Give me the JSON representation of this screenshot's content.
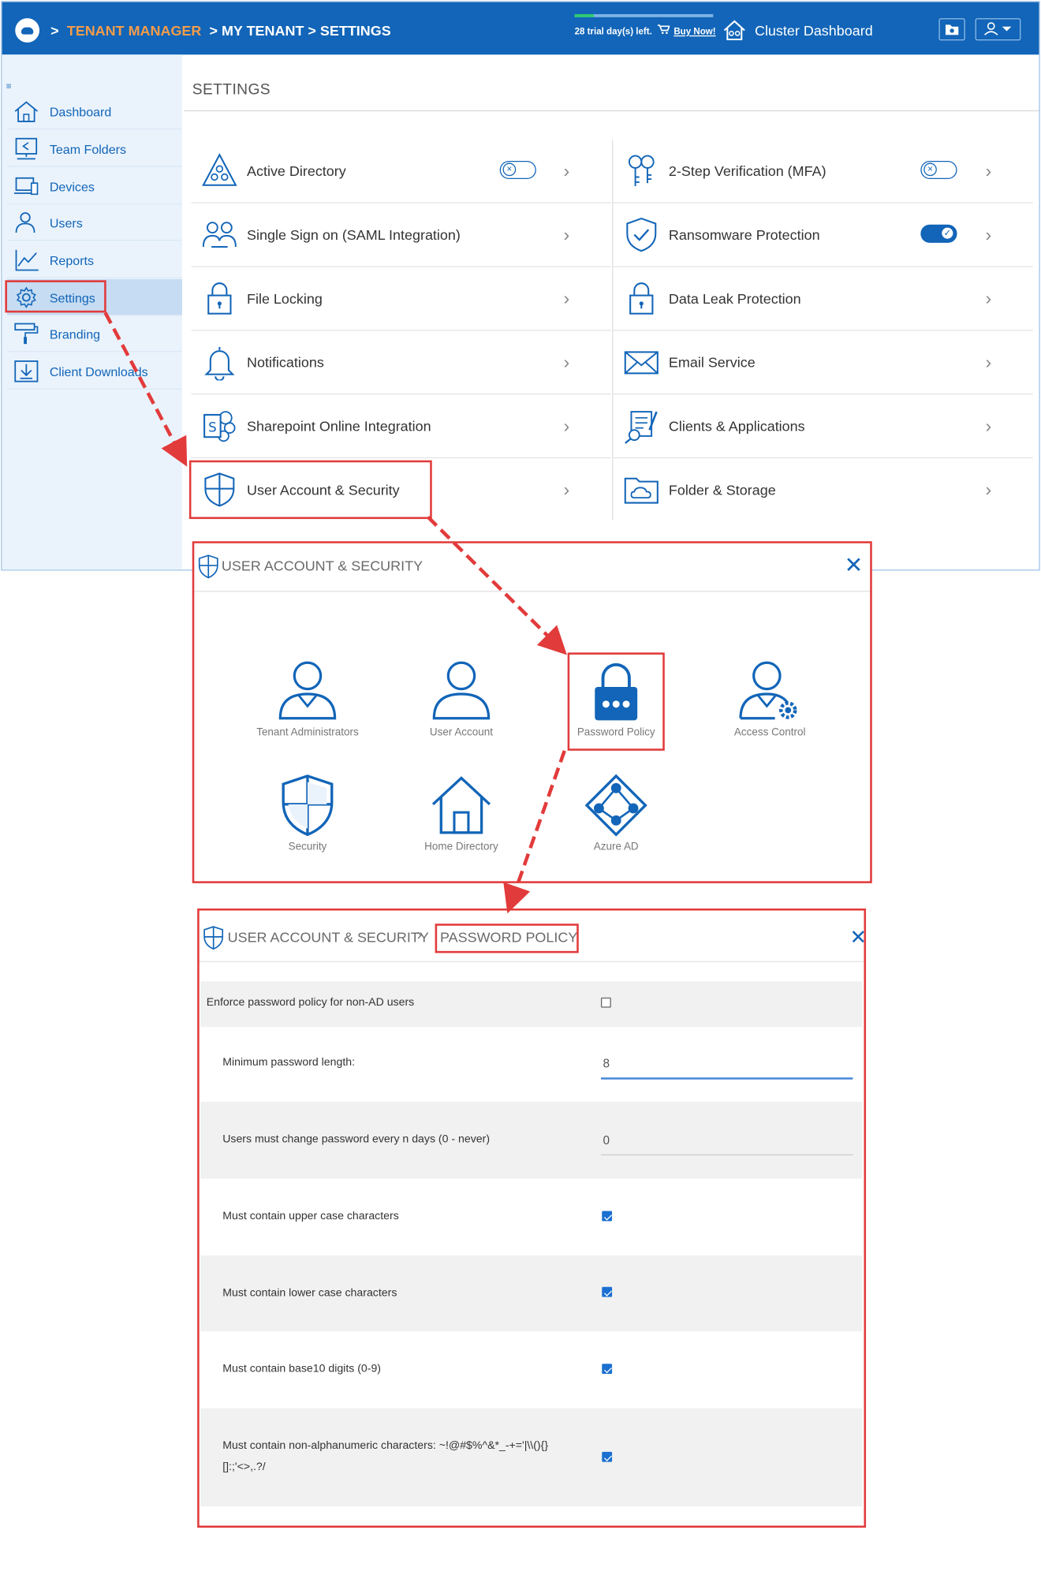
{
  "topbar": {
    "breadcrumb": [
      ">",
      "TENANT MANAGER",
      "> MY TENANT",
      "> SETTINGS"
    ],
    "trial_text": "28 trial day(s) left.",
    "trial_progress": 0.14,
    "buy_now": "Buy Now!",
    "cluster_dashboard": "Cluster Dashboard"
  },
  "sidebar": {
    "items": [
      {
        "label": "Dashboard",
        "icon": "home-icon"
      },
      {
        "label": "Team Folders",
        "icon": "team-folders-icon"
      },
      {
        "label": "Devices",
        "icon": "devices-icon"
      },
      {
        "label": "Users",
        "icon": "users-icon"
      },
      {
        "label": "Reports",
        "icon": "reports-icon"
      },
      {
        "label": "Settings",
        "icon": "gear-icon",
        "active": true
      },
      {
        "label": "Branding",
        "icon": "paint-roller-icon"
      },
      {
        "label": "Client Downloads",
        "icon": "download-icon"
      }
    ]
  },
  "settings": {
    "title": "SETTINGS",
    "left": [
      {
        "label": "Active Directory",
        "toggle": "off"
      },
      {
        "label": "Single Sign on (SAML Integration)"
      },
      {
        "label": "File Locking"
      },
      {
        "label": "Notifications"
      },
      {
        "label": "Sharepoint Online Integration"
      },
      {
        "label": "User Account & Security"
      }
    ],
    "right": [
      {
        "label": "2-Step Verification (MFA)",
        "toggle": "off"
      },
      {
        "label": "Ransomware Protection",
        "toggle": "on"
      },
      {
        "label": "Data Leak Protection"
      },
      {
        "label": "Email Service"
      },
      {
        "label": "Clients & Applications"
      },
      {
        "label": "Folder & Storage"
      }
    ]
  },
  "popup1": {
    "title": "USER ACCOUNT & SECURITY",
    "tiles": [
      {
        "label": "Tenant Administrators",
        "icon": "admin-user-icon"
      },
      {
        "label": "User Account",
        "icon": "user-icon"
      },
      {
        "label": "Password Policy",
        "icon": "password-lock-icon"
      },
      {
        "label": "Access Control",
        "icon": "user-gear-icon"
      },
      {
        "label": "Security",
        "icon": "shield-icon"
      },
      {
        "label": "Home Directory",
        "icon": "house-icon"
      },
      {
        "label": "Azure AD",
        "icon": "azure-ad-icon"
      }
    ]
  },
  "popup2": {
    "crumb_parent": "USER ACCOUNT & SECURITY",
    "crumb_current": "PASSWORD POLICY",
    "rows": {
      "enforce": {
        "label": "Enforce password policy for non-AD users",
        "checked": false
      },
      "min_length": {
        "label": "Minimum password length:",
        "value": "8"
      },
      "change_days": {
        "label": "Users must change password every n days (0 - never)",
        "value": "0"
      },
      "upper": {
        "label": "Must contain upper case characters",
        "checked": true
      },
      "lower": {
        "label": "Must contain lower case characters",
        "checked": true
      },
      "digits": {
        "label": "Must contain base10 digits (0-9)",
        "checked": true
      },
      "nonalpha": {
        "label": "Must contain non-alphanumeric characters: ~!@#$%^&*_-+='|\\\\(){}[]:;'<>,.?/",
        "checked": true
      }
    }
  },
  "colors": {
    "brand_blue": "#1265b8",
    "breadcrumb_orange": "#f39c4a",
    "highlight_red": "#e23b3b",
    "sidebar_bg": "#eaf3fc"
  }
}
